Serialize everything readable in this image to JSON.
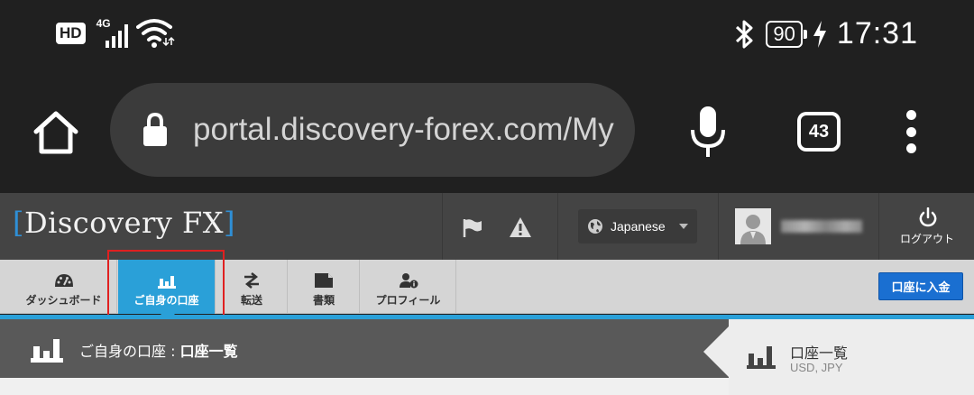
{
  "status_bar": {
    "hd_label": "HD",
    "network_label": "4G",
    "battery_level": "90",
    "time": "17:31"
  },
  "browser": {
    "url": "portal.discovery-forex.com/My",
    "tab_count": "43"
  },
  "site": {
    "logo_text": "Discovery FX",
    "language": "Japanese",
    "logout_label": "ログアウト"
  },
  "nav": {
    "items": [
      {
        "label": "ダッシュボード",
        "icon": "dashboard-gauge-icon"
      },
      {
        "label": "ご自身の口座",
        "icon": "bar-chart-icon",
        "active": true
      },
      {
        "label": "転送",
        "icon": "transfer-arrows-icon"
      },
      {
        "label": "書類",
        "icon": "document-icon"
      },
      {
        "label": "プロフィール",
        "icon": "profile-info-icon"
      }
    ],
    "deposit_label": "口座に入金"
  },
  "content": {
    "breadcrumb_section": "ご自身の口座 : ",
    "breadcrumb_page": "口座一覧",
    "panel_title": "口座一覧",
    "panel_subtitle": "USD, JPY"
  },
  "colors": {
    "accent": "#2aa0d8",
    "deposit_button": "#1a6fd1",
    "highlight": "#e02020",
    "header_bg": "#444444"
  }
}
